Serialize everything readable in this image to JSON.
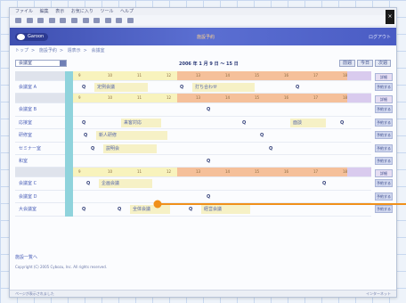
{
  "menu": [
    "ファイル",
    "編集",
    "表示",
    "お気に入り",
    "ツール",
    "ヘルプ"
  ],
  "window": {
    "close_label": "×"
  },
  "header": {
    "logo_text": "Garoon",
    "center_text": "施設予約",
    "right_text": "ログアウト"
  },
  "breadcrumb": [
    "トップ",
    "施設予約",
    "週表示",
    "会議室"
  ],
  "controls": {
    "facility_select": "会議室",
    "date_range": "2006 年 1 月 9 日 ～ 15 日",
    "prev_label": "前週",
    "next_label": "次週",
    "today_label": "今日"
  },
  "scale_ticks": [
    "9",
    "10",
    "11",
    "12",
    "13",
    "14",
    "15",
    "16",
    "17",
    "18"
  ],
  "scale_action": "詳細",
  "rows": [
    {
      "type": "scale"
    },
    {
      "type": "data",
      "name": "会議室 A",
      "action": "予約する",
      "events": [
        {
          "mark": "Q",
          "label": "定例会議"
        },
        {
          "mark": "Q",
          "label": "打ち合わせ"
        },
        {
          "mark": "Q",
          "label": ""
        }
      ]
    },
    {
      "type": "scale"
    },
    {
      "type": "data",
      "name": "会議室 B",
      "action": "予約する",
      "events": [
        {
          "mark": "Q",
          "label": ""
        }
      ]
    },
    {
      "type": "data",
      "name": "応接室",
      "action": "予約する",
      "events": [
        {
          "mark": "Q",
          "label": ""
        },
        {
          "mark": "",
          "label": "来客対応"
        },
        {
          "mark": "Q",
          "label": ""
        },
        {
          "mark": "",
          "label": "面談"
        },
        {
          "mark": "Q",
          "label": ""
        }
      ]
    },
    {
      "type": "data",
      "name": "研修室",
      "action": "予約する",
      "events": [
        {
          "mark": "Q",
          "label": "新人研修"
        },
        {
          "mark": "Q",
          "label": ""
        }
      ]
    },
    {
      "type": "data",
      "name": "セミナー室",
      "action": "予約する",
      "events": [
        {
          "mark": "Q",
          "label": "説明会"
        },
        {
          "mark": "Q",
          "label": ""
        }
      ]
    },
    {
      "type": "data",
      "name": "和室",
      "action": "予約する",
      "events": [
        {
          "mark": "Q",
          "label": ""
        }
      ]
    },
    {
      "type": "scale"
    },
    {
      "type": "data",
      "name": "会議室 C",
      "action": "予約する",
      "events": [
        {
          "mark": "Q",
          "label": "企画会議"
        },
        {
          "mark": "Q",
          "label": ""
        }
      ]
    },
    {
      "type": "data",
      "name": "会議室 D",
      "action": "予約する",
      "events": [
        {
          "mark": "Q",
          "label": ""
        }
      ]
    },
    {
      "type": "data",
      "name": "大会議室",
      "action": "予約する",
      "events": [
        {
          "mark": "Q",
          "label": ""
        },
        {
          "mark": "Q",
          "label": "全体会議"
        },
        {
          "mark": "Q",
          "label": "経営会議"
        }
      ]
    }
  ],
  "footer_link": "施設一覧へ",
  "copyright": "Copyright (C) 2005 Cybozu, Inc. All rights reserved.",
  "status_left": "ページが表示されました",
  "status_right": "インターネット",
  "colors": {
    "accent": "#3e4fb0",
    "annotation": "#f0901a",
    "scale_yellow": "#f8f3bd",
    "scale_orange": "#f5c09a",
    "teal": "#8fd3dc"
  }
}
